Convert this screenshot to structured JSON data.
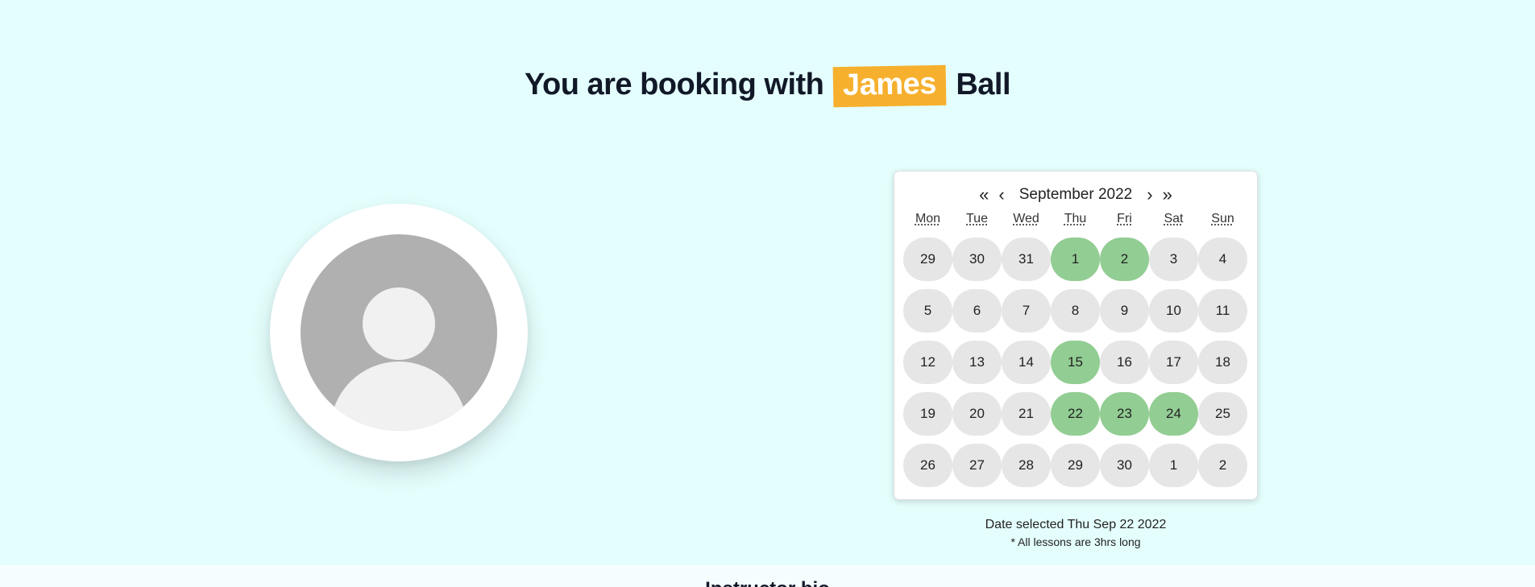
{
  "heading": {
    "prefix": "You are booking with",
    "first_name": "James",
    "last_name": "Ball",
    "highlight_color": "#f6b02e"
  },
  "avatar": {
    "icon": "user-placeholder-icon"
  },
  "calendar": {
    "prev_year_label": "«",
    "prev_month_label": "‹",
    "month_title": "September 2022",
    "next_month_label": "›",
    "next_year_label": "»",
    "weekdays": [
      "Mon",
      "Tue",
      "Wed",
      "Thu",
      "Fri",
      "Sat",
      "Sun"
    ],
    "available_color": "#92cd93",
    "default_color": "#e6e6e6",
    "weeks": [
      [
        {
          "label": "29",
          "available": false
        },
        {
          "label": "30",
          "available": false
        },
        {
          "label": "31",
          "available": false
        },
        {
          "label": "1",
          "available": true
        },
        {
          "label": "2",
          "available": true
        },
        {
          "label": "3",
          "available": false
        },
        {
          "label": "4",
          "available": false
        }
      ],
      [
        {
          "label": "5",
          "available": false
        },
        {
          "label": "6",
          "available": false
        },
        {
          "label": "7",
          "available": false
        },
        {
          "label": "8",
          "available": false
        },
        {
          "label": "9",
          "available": false
        },
        {
          "label": "10",
          "available": false
        },
        {
          "label": "11",
          "available": false
        }
      ],
      [
        {
          "label": "12",
          "available": false
        },
        {
          "label": "13",
          "available": false
        },
        {
          "label": "14",
          "available": false
        },
        {
          "label": "15",
          "available": true
        },
        {
          "label": "16",
          "available": false
        },
        {
          "label": "17",
          "available": false
        },
        {
          "label": "18",
          "available": false
        }
      ],
      [
        {
          "label": "19",
          "available": false
        },
        {
          "label": "20",
          "available": false
        },
        {
          "label": "21",
          "available": false
        },
        {
          "label": "22",
          "available": true
        },
        {
          "label": "23",
          "available": true
        },
        {
          "label": "24",
          "available": true
        },
        {
          "label": "25",
          "available": false
        }
      ],
      [
        {
          "label": "26",
          "available": false
        },
        {
          "label": "27",
          "available": false
        },
        {
          "label": "28",
          "available": false
        },
        {
          "label": "29",
          "available": false
        },
        {
          "label": "30",
          "available": false
        },
        {
          "label": "1",
          "available": false
        },
        {
          "label": "2",
          "available": false
        }
      ]
    ]
  },
  "selection": {
    "date_selected_text": "Date selected Thu Sep 22 2022",
    "note": "* All lessons are 3hrs long"
  },
  "bio": {
    "title": "Instructor bio"
  }
}
